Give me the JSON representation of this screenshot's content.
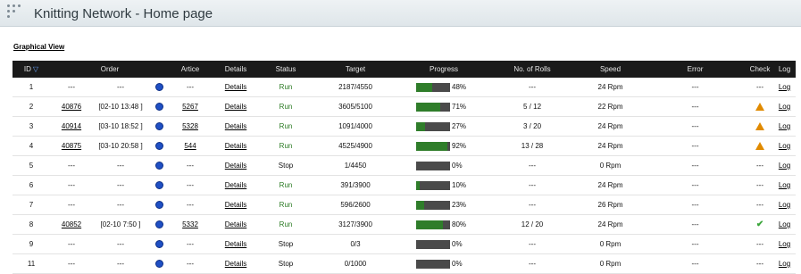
{
  "app": {
    "title": "Knitting Network - Home page"
  },
  "graphical_view_link": "Graphical View",
  "table": {
    "headers": {
      "id": "ID",
      "order": "Order",
      "article": "Artice",
      "details": "Details",
      "status": "Status",
      "target": "Target",
      "progress": "Progress",
      "rolls": "No. of Rolls",
      "speed": "Speed",
      "error": "Error",
      "check": "Check",
      "log": "Log"
    },
    "rows": [
      {
        "id": "1",
        "order": "---",
        "date": "---",
        "article": "---",
        "details": "Details",
        "status": "Run",
        "target": "2187/4550",
        "progress": 48,
        "progress_label": "48%",
        "rolls": "---",
        "speed": "24 Rpm",
        "error": "---",
        "check": "---",
        "log": "Log"
      },
      {
        "id": "2",
        "order": "40876",
        "date": "[02-10 13:48 ]",
        "article": "5267",
        "details": "Details",
        "status": "Run",
        "target": "3605/5100",
        "progress": 71,
        "progress_label": "71%",
        "rolls": "5 / 12",
        "speed": "22 Rpm",
        "error": "---",
        "check": "warning-icon",
        "log": "Log"
      },
      {
        "id": "3",
        "order": "40914",
        "date": "[03-10 18:52 ]",
        "article": "5328",
        "details": "Details",
        "status": "Run",
        "target": "1091/4000",
        "progress": 27,
        "progress_label": "27%",
        "rolls": "3 / 20",
        "speed": "24 Rpm",
        "error": "---",
        "check": "warning-icon",
        "log": "Log"
      },
      {
        "id": "4",
        "order": "40875",
        "date": "[03-10 20:58 ]",
        "article": "544",
        "details": "Details",
        "status": "Run",
        "target": "4525/4900",
        "progress": 92,
        "progress_label": "92%",
        "rolls": "13 / 28",
        "speed": "24 Rpm",
        "error": "---",
        "check": "warning-icon",
        "log": "Log"
      },
      {
        "id": "5",
        "order": "---",
        "date": "---",
        "article": "---",
        "details": "Details",
        "status": "Stop",
        "target": "1/4450",
        "progress": 0,
        "progress_label": "0%",
        "rolls": "---",
        "speed": "0 Rpm",
        "error": "---",
        "check": "---",
        "log": "Log"
      },
      {
        "id": "6",
        "order": "---",
        "date": "---",
        "article": "---",
        "details": "Details",
        "status": "Run",
        "target": "391/3900",
        "progress": 10,
        "progress_label": "10%",
        "rolls": "---",
        "speed": "24 Rpm",
        "error": "---",
        "check": "---",
        "log": "Log"
      },
      {
        "id": "7",
        "order": "---",
        "date": "---",
        "article": "---",
        "details": "Details",
        "status": "Run",
        "target": "596/2600",
        "progress": 23,
        "progress_label": "23%",
        "rolls": "---",
        "speed": "26 Rpm",
        "error": "---",
        "check": "---",
        "log": "Log"
      },
      {
        "id": "8",
        "order": "40852",
        "date": "[02-10 7:50 ]",
        "article": "5332",
        "details": "Details",
        "status": "Run",
        "target": "3127/3900",
        "progress": 80,
        "progress_label": "80%",
        "rolls": "12 / 20",
        "speed": "24 Rpm",
        "error": "---",
        "check": "checkmark-icon",
        "log": "Log"
      },
      {
        "id": "9",
        "order": "---",
        "date": "---",
        "article": "---",
        "details": "Details",
        "status": "Stop",
        "target": "0/3",
        "progress": 0,
        "progress_label": "0%",
        "rolls": "---",
        "speed": "0 Rpm",
        "error": "---",
        "check": "---",
        "log": "Log"
      },
      {
        "id": "11",
        "order": "---",
        "date": "---",
        "article": "---",
        "details": "Details",
        "status": "Stop",
        "target": "0/1000",
        "progress": 0,
        "progress_label": "0%",
        "rolls": "---",
        "speed": "0 Rpm",
        "error": "---",
        "check": "---",
        "log": "Log"
      }
    ]
  },
  "colors": {
    "header_bg": "#1a1a1a",
    "progress_fill": "#2f7d2a",
    "progress_empty": "#4a4a4a",
    "run": "#2a7a22",
    "warning": "#e08a00",
    "ok": "#3aa53a",
    "info": "#1f4fc4"
  }
}
